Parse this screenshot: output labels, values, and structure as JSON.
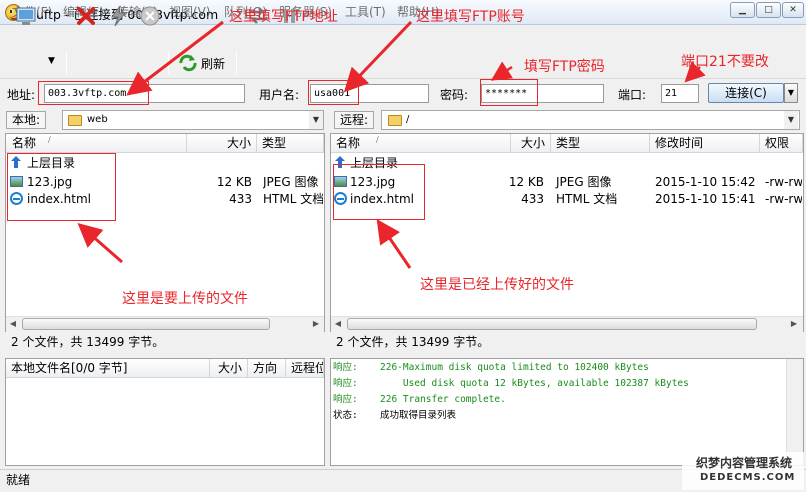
{
  "window": {
    "title": "8uftp - 已连接到 003.3vftp.com",
    "min": "▁",
    "max": "□",
    "close": "✕"
  },
  "menu": [
    "文件(F)",
    "编辑(E)",
    "传输(T)",
    "视图(V)",
    "队列(Q)",
    "服务器(S)",
    "工具(T)",
    "帮助(H)"
  ],
  "toolbar": {
    "refresh_label": "刷新"
  },
  "connection": {
    "address_label": "地址:",
    "address_value": "003.3vftp.com",
    "user_label": "用户名:",
    "user_value": "usa001",
    "password_label": "密码:",
    "password_value": "*******",
    "port_label": "端口:",
    "port_value": "21",
    "connect_label": "连接(C)"
  },
  "local": {
    "path_label": "本地:",
    "path_value": "web",
    "columns": {
      "name": "名称",
      "size": "大小",
      "type": "类型"
    },
    "files": [
      {
        "name": "上层目录",
        "size": "",
        "type": ""
      },
      {
        "name": "123.jpg",
        "size": "12 KB",
        "type": "JPEG 图像"
      },
      {
        "name": "index.html",
        "size": "433",
        "type": "HTML 文档"
      }
    ],
    "status": "2 个文件，共 13499 字节。"
  },
  "remote": {
    "path_label": "远程:",
    "path_value": "/",
    "columns": {
      "name": "名称",
      "size": "大小",
      "type": "类型",
      "modified": "修改时间",
      "perm": "权限"
    },
    "files": [
      {
        "name": "上层目录",
        "size": "",
        "type": "",
        "modified": "",
        "perm": ""
      },
      {
        "name": "123.jpg",
        "size": "12 KB",
        "type": "JPEG 图像",
        "modified": "2015-1-10 15:42",
        "perm": "-rw-rw"
      },
      {
        "name": "index.html",
        "size": "433",
        "type": "HTML 文档",
        "modified": "2015-1-10 15:41",
        "perm": "-rw-rw"
      }
    ],
    "status": "2 个文件，共 13499 字节。"
  },
  "queue": {
    "columns": {
      "name": "本地文件名[0/0 字节]",
      "size": "大小",
      "direction": "方向",
      "remote": "远程位"
    }
  },
  "log": [
    {
      "label": "响应:",
      "text": "226-Maximum disk quota limited to 102400 kBytes",
      "color": "#1a8c1a"
    },
    {
      "label": "响应:",
      "text": "    Used disk quota 12 kBytes, available 102387 kBytes",
      "color": "#1a8c1a"
    },
    {
      "label": "响应:",
      "text": "226 Transfer complete.",
      "color": "#1a8c1a"
    },
    {
      "label": "状态:",
      "text": "成功取得目录列表",
      "color": "#000000"
    }
  ],
  "statusbar": {
    "text": "就绪"
  },
  "annotations": {
    "ftp_address": "这里填写FTP地址",
    "ftp_account": "这里填写FTP账号",
    "ftp_password": "填写FTP密码",
    "port_note": "端口21不要改",
    "local_note": "这里是要上传的文件",
    "remote_note": "这里是已经上传好的文件"
  },
  "watermark": {
    "line1": "织梦内容管理系统",
    "line2": "DEDECMS.COM"
  },
  "accent_red": "#e8262b"
}
